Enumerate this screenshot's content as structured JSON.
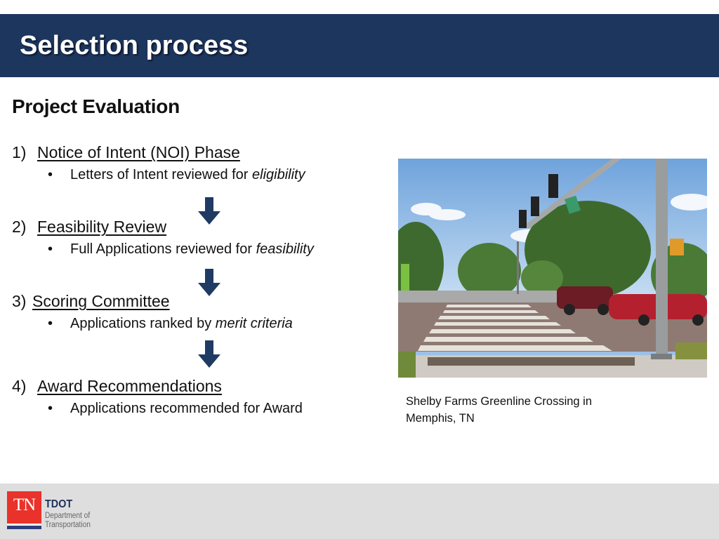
{
  "header": {
    "title": "Selection process"
  },
  "content": {
    "subheading": "Project Evaluation",
    "steps": [
      {
        "number": "1)",
        "title": "Notice of Intent (NOI) Phase",
        "bullet": "•",
        "detail_plain": "Letters of Intent reviewed for ",
        "detail_emphasis": "eligibility"
      },
      {
        "number": "2)",
        "title": "Feasibility Review",
        "bullet": "•",
        "detail_plain": "Full Applications reviewed for ",
        "detail_emphasis": "feasibility"
      },
      {
        "number": "3)",
        "title": "Scoring Committee",
        "bullet": "•",
        "detail_plain": "Applications ranked by ",
        "detail_emphasis": "merit criteria"
      },
      {
        "number": "4)",
        "title": "Award Recommendations",
        "bullet": "•",
        "detail_plain": "Applications recommended for Award",
        "detail_emphasis": ""
      }
    ],
    "arrow_icon": "arrow-down-icon",
    "arrow_color": "#1f3a63"
  },
  "photo": {
    "subject": "Pedestrian crosswalk at a signalized intersection with traffic lights, trees and red cars",
    "caption_line1": "Shelby Farms Greenline Crossing in",
    "caption_line2": "Memphis, TN"
  },
  "footer": {
    "logo_mark": "TN",
    "org_short": "TDOT",
    "org_line1": "Department of",
    "org_line2": "Transportation",
    "brand_red": "#e8322a",
    "brand_navy": "#1e2f5a"
  },
  "colors": {
    "title_bar": "#1d365e",
    "footer_bg": "#dedede"
  }
}
